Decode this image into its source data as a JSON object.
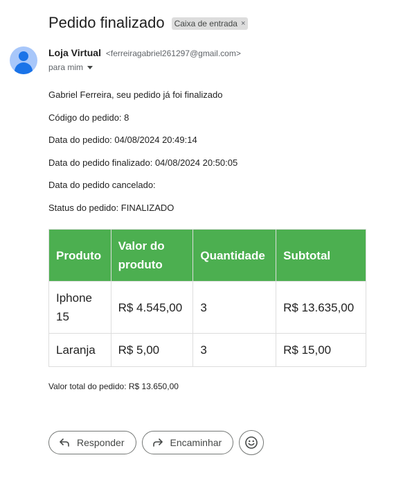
{
  "email": {
    "subject": "Pedido finalizado",
    "label_chip": "Caixa de entrada",
    "label_chip_close": "×",
    "sender_name": "Loja Virtual",
    "sender_email": "<ferreiragabriel261297@gmail.com>",
    "recipient": "para mim"
  },
  "body": {
    "lines": [
      "Gabriel Ferreira, seu pedido já foi finalizado",
      "Código do pedido: 8",
      "Data do pedido: 04/08/2024 20:49:14",
      "Data do pedido finalizado: 04/08/2024 20:50:05",
      "Data do pedido cancelado:",
      "Status do pedido: FINALIZADO"
    ]
  },
  "table": {
    "headers": [
      "Produto",
      "Valor do produto",
      "Quantidade",
      "Subtotal"
    ],
    "rows": [
      [
        "Iphone 15",
        "R$ 4.545,00",
        "3",
        "R$ 13.635,00"
      ],
      [
        "Laranja",
        "R$ 5,00",
        "3",
        "R$ 15,00"
      ]
    ],
    "header_color": "#4caf50"
  },
  "total": "Valor total do pedido: R$ 13.650,00",
  "actions": {
    "reply_label": "Responder",
    "forward_label": "Encaminhar"
  },
  "icons": {
    "reply": "reply-icon",
    "forward": "forward-icon",
    "emoji": "emoji-icon",
    "caret": "chevron-down-icon",
    "avatar": "person-avatar"
  }
}
